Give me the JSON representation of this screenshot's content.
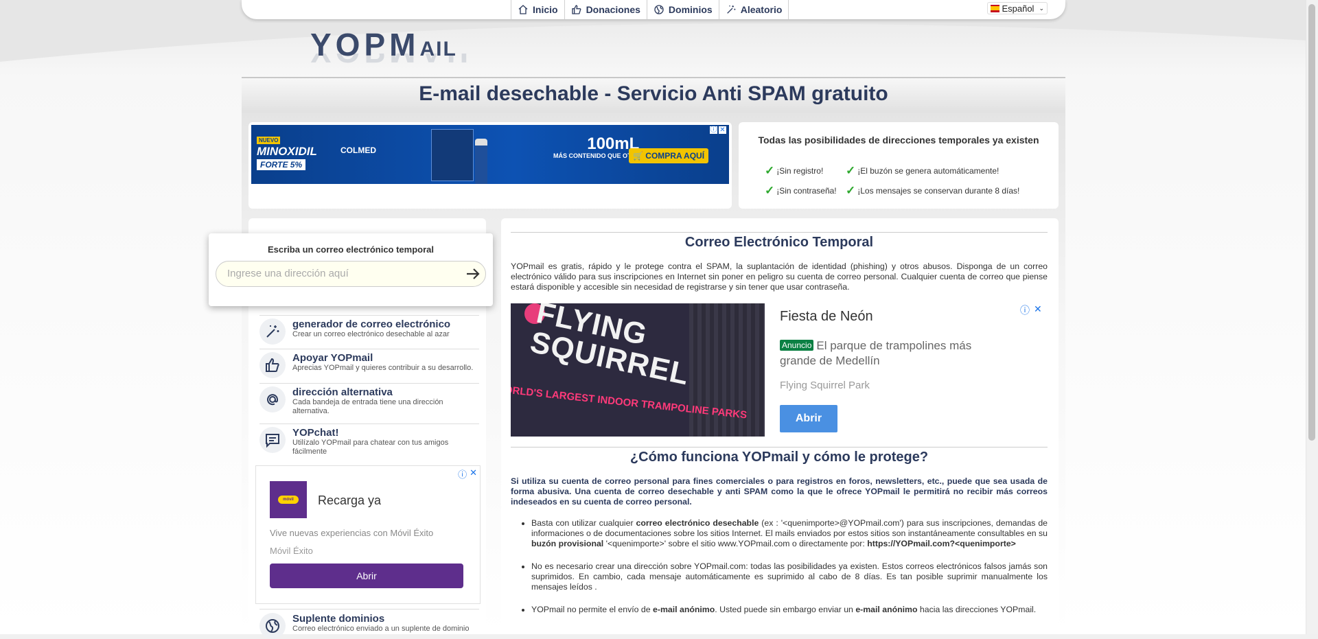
{
  "nav": {
    "items": [
      {
        "label": "Inicio",
        "icon": "home-icon"
      },
      {
        "label": "Donaciones",
        "icon": "thumbs-up-icon"
      },
      {
        "label": "Dominios",
        "icon": "globe-icon"
      },
      {
        "label": "Aleatorio",
        "icon": "magic-wand-icon"
      }
    ],
    "language": "Español"
  },
  "logo": {
    "text_main": "YOPM",
    "text_small": "AIL"
  },
  "page_title": "E-mail desechable - Servicio Anti SPAM gratuito",
  "ad_top": {
    "new_tag": "NUEVO",
    "product": "MINOXIDIL",
    "product2": "FORTE 5%",
    "brand": "COLMED",
    "volume": "100mL",
    "volume_sub": "MÁS CONTENIDO QUE OTRAS MARCAS",
    "cta": "COMPRA AQUÍ"
  },
  "features": {
    "title": "Todas las posibilidades de direcciones temporales ya existen",
    "items": [
      "¡Sin registro!",
      "¡El buzón se genera automáticamente!",
      "¡Sin contraseña!",
      "¡Los mensajes se conservan durante 8 días!"
    ]
  },
  "search": {
    "label": "Escriba un correo electrónico temporal",
    "placeholder": "Ingrese una dirección aquí"
  },
  "menu": [
    {
      "title": "generador de correo electrónico",
      "desc": "Crear un correo electrónico desechable al azar",
      "icon": "magic-wand-icon"
    },
    {
      "title": "Apoyar YOPmail",
      "desc": "Aprecias YOPmail y quieres contribuir a su desarrollo.",
      "icon": "thumbs-up-icon"
    },
    {
      "title": "dirección alternativa",
      "desc": "Cada bandeja de entrada tiene una dirección alternativa.",
      "icon": "at-icon"
    },
    {
      "title": "YOPchat!",
      "desc": "Utilízalo YOPmail para chatear con tus amigos fácilmente",
      "icon": "chat-icon"
    },
    {
      "title": "Suplente dominios",
      "desc": "Correo electrónico enviado a un suplente de dominio",
      "icon": "globe-icon"
    }
  ],
  "ad_left": {
    "logo_text": "móvil éxito",
    "title": "Recarga ya",
    "line1": "Vive nuevas experiencias con Móvil Éxito",
    "line2": "Móvil Éxito",
    "button": "Abrir"
  },
  "main": {
    "heading": "Correo Electrónico Temporal",
    "intro": "YOPmail es gratis, rápido y le protege contra el SPAM, la suplantación de identidad (phishing) y otros abusos. Disponga de un correo electrónico válido para sus inscripciones en Internet sin poner en peligro su cuenta de correo personal. Cualquier cuenta de correo que piense estará disponible y accesible sin necesidad de registrarse y sin tener que usar contraseña.",
    "ad": {
      "photo_text": "FLYING SQUIRREL",
      "photo_strip": "ORLD'S LARGEST INDOOR TRAMPOLINE PARKS",
      "title": "Fiesta de Neón",
      "badge": "Anuncio",
      "sub": "El parque de trampolines más grande de Medellín",
      "brand": "Flying Squirrel Park",
      "button": "Abrir"
    },
    "heading2": "¿Cómo funciona YOPmail y cómo le protege?",
    "bold_intro": "Si utiliza su cuenta de correo personal para fines comerciales o para registros en foros, newsletters, etc., puede que sea usada de forma abusiva. Una cuenta de correo desechable y anti SPAM como la que le ofrece YOPmail le permitirá no recibir más correos indeseados en su cuenta de correo personal.",
    "bullets": [
      {
        "pre": "Basta con utilizar cualquier ",
        "b1": "correo electrónico desechable",
        "mid": " (ex : '<quenimporte>@YOPmail.com') para sus inscripciones, demandas de informaciones o de documentaciones sobre los sitios Internet. El mails enviados por estos sitios son instantáneamente consultables en su ",
        "b2": "buzón provisional",
        "post": " '<quenimporte>' sobre el sitio www.YOPmail.com o directamente por: ",
        "b3": "https://YOPmail.com?<quenimporte>"
      },
      {
        "text": "No es necesario crear una dirección sobre YOPmail.com: todas las posibilidades ya existen. Estos correos electrónicos falsos jamás son suprimidos. En cambio, cada mensaje automáticamente es suprimido al cabo de 8 días. Es tan posible suprimir manualmente los mensajes leídos ."
      },
      {
        "pre": "YOPmail no permite el envío de ",
        "b1": "e-mail anónimo",
        "mid": ". Usted puede sin embargo enviar un ",
        "b2": "e-mail anónimo",
        "post": " hacia las direcciones YOPmail."
      }
    ]
  }
}
